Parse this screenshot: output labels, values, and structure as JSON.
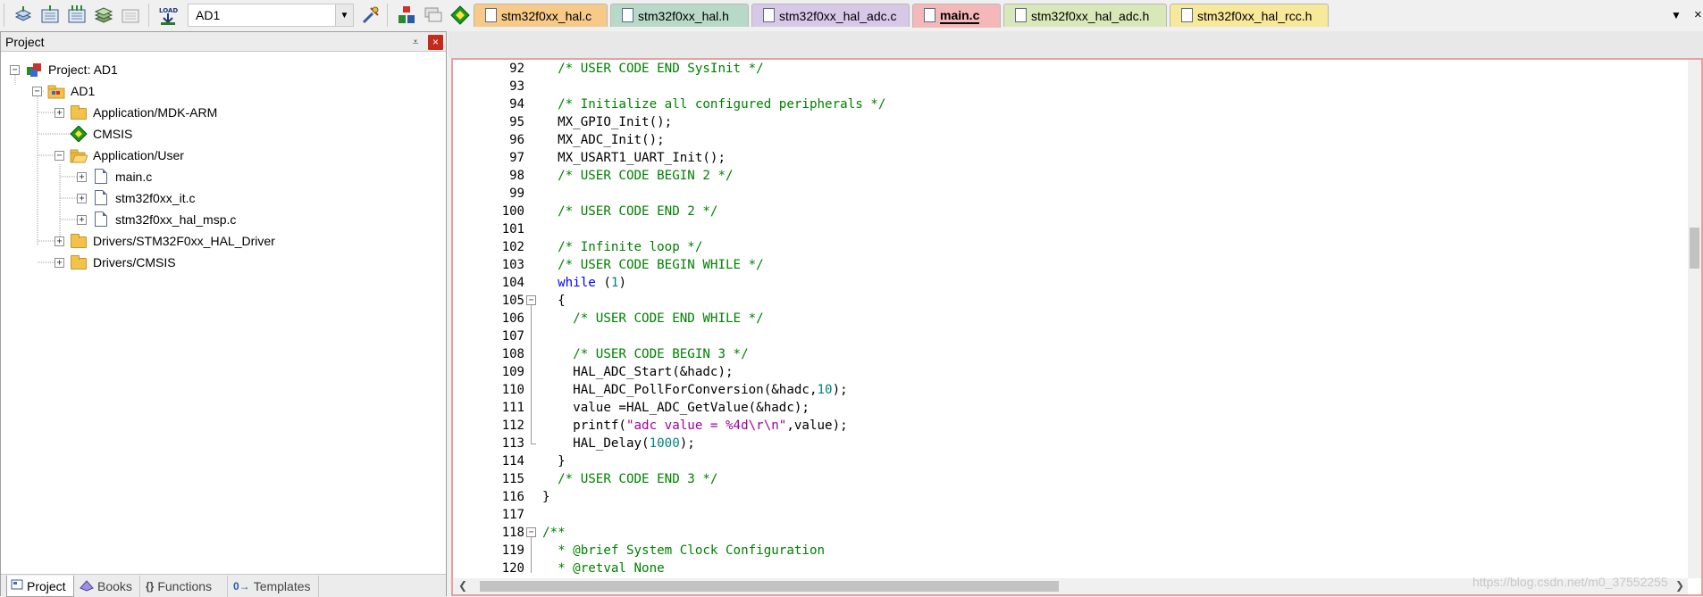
{
  "toolbar": {
    "target": "AD1",
    "icons": [
      "translate-icon",
      "build-icon",
      "rebuild-icon",
      "batch-build-icon",
      "stop-build-icon",
      "load-icon",
      "options-for-target-icon",
      "manage-project-items-icon",
      "select-packs-icon",
      "manage-runtime-icon",
      "pack-installer-icon",
      "events-icon"
    ],
    "load_label": "LOAD"
  },
  "project_panel": {
    "title": "Project",
    "pin": "⩡",
    "close": "×",
    "tree": [
      {
        "label": "Project: AD1",
        "icon": "project-icon"
      },
      {
        "label": "AD1",
        "icon": "target-folder-icon"
      },
      {
        "label": "Application/MDK-ARM",
        "icon": "folder-icon"
      },
      {
        "label": "CMSIS",
        "icon": "cmsis-diamond-icon"
      },
      {
        "label": "Application/User",
        "icon": "folder-open-icon"
      },
      {
        "label": "main.c",
        "icon": "file-icon"
      },
      {
        "label": "stm32f0xx_it.c",
        "icon": "file-icon"
      },
      {
        "label": "stm32f0xx_hal_msp.c",
        "icon": "file-icon"
      },
      {
        "label": "Drivers/STM32F0xx_HAL_Driver",
        "icon": "folder-icon"
      },
      {
        "label": "Drivers/CMSIS",
        "icon": "folder-icon"
      }
    ],
    "bottom_tabs": [
      {
        "label": "Project",
        "icon": "project-tab-icon"
      },
      {
        "label": "Books",
        "icon": "books-icon"
      },
      {
        "label": "Functions",
        "icon": "{}"
      },
      {
        "label": "Templates",
        "icon": "0→"
      }
    ]
  },
  "editor": {
    "tabs": [
      {
        "label": "stm32f0xx_hal.c",
        "color": "#f7ca88"
      },
      {
        "label": "stm32f0xx_hal.h",
        "color": "#b8d8c8"
      },
      {
        "label": "stm32f0xx_hal_adc.c",
        "color": "#d8c8e8"
      },
      {
        "label": "main.c",
        "color": "#f4b8b8"
      },
      {
        "label": "stm32f0xx_hal_adc.h",
        "color": "#d8e8b8"
      },
      {
        "label": "stm32f0xx_hal_rcc.h",
        "color": "#f8e89a"
      }
    ],
    "active_tab": "main.c",
    "tab_menu": "▼",
    "tab_close": "×",
    "lines": [
      {
        "n": "92",
        "code": "  /* USER CODE END SysInit */"
      },
      {
        "n": "93",
        "code": ""
      },
      {
        "n": "94",
        "code": "  /* Initialize all configured peripherals */"
      },
      {
        "n": "95",
        "code": "  MX_GPIO_Init();"
      },
      {
        "n": "96",
        "code": "  MX_ADC_Init();"
      },
      {
        "n": "97",
        "code": "  MX_USART1_UART_Init();"
      },
      {
        "n": "98",
        "code": "  /* USER CODE BEGIN 2 */"
      },
      {
        "n": "99",
        "code": ""
      },
      {
        "n": "100",
        "code": "  /* USER CODE END 2 */"
      },
      {
        "n": "101",
        "code": ""
      },
      {
        "n": "102",
        "code": "  /* Infinite loop */"
      },
      {
        "n": "103",
        "code": "  /* USER CODE BEGIN WHILE */"
      },
      {
        "n": "104",
        "code": "  while (1)"
      },
      {
        "n": "105",
        "code": "  {"
      },
      {
        "n": "106",
        "code": "    /* USER CODE END WHILE */"
      },
      {
        "n": "107",
        "code": ""
      },
      {
        "n": "108",
        "code": "    /* USER CODE BEGIN 3 */"
      },
      {
        "n": "109",
        "code": "    HAL_ADC_Start(&hadc);"
      },
      {
        "n": "110",
        "code": "    HAL_ADC_PollForConversion(&hadc,10);"
      },
      {
        "n": "111",
        "code": "    value =HAL_ADC_GetValue(&hadc);"
      },
      {
        "n": "112",
        "code": "    printf(\"adc value = %4d\\r\\n\",value);"
      },
      {
        "n": "113",
        "code": "    HAL_Delay(1000);"
      },
      {
        "n": "114",
        "code": "  }"
      },
      {
        "n": "115",
        "code": "  /* USER CODE END 3 */"
      },
      {
        "n": "116",
        "code": "}"
      },
      {
        "n": "117",
        "code": ""
      },
      {
        "n": "118",
        "code": "/**"
      },
      {
        "n": "119",
        "code": "  * @brief System Clock Configuration"
      },
      {
        "n": "120",
        "code": "  * @retval None"
      }
    ]
  },
  "watermark": "https://blog.csdn.net/m0_37552255"
}
